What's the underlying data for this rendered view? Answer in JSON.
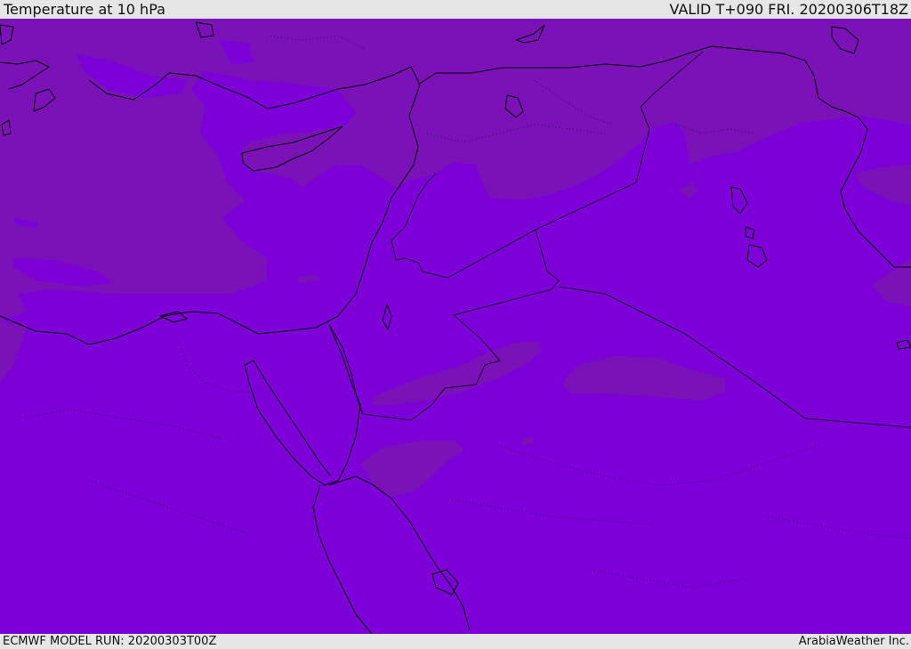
{
  "header": {
    "title": "Temperature at 10 hPa",
    "valid_time": "VALID T+090 FRI. 20200306T18Z"
  },
  "footer": {
    "model_run": "ECMWF MODEL RUN: 20200303T00Z",
    "credit": "ArabiaWeather Inc."
  },
  "map": {
    "colors": {
      "base": "#7d00d9",
      "warm_band": "#7a12b8",
      "coastline": "#000000"
    },
    "icons": [
      "coastline-lines",
      "country-borders",
      "admin-borders"
    ]
  }
}
